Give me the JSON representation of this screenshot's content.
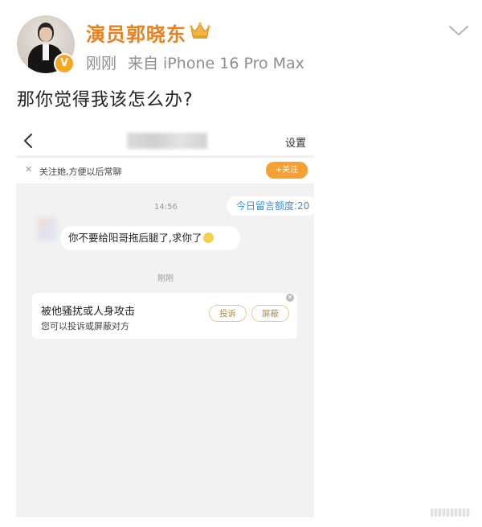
{
  "post": {
    "username": "演员郭晓东",
    "time": "刚刚",
    "source": "来自 iPhone 16 Pro Max",
    "text": "那你觉得我该怎么办?",
    "accent_color": "#e8811e",
    "badge_color": "#f6a623",
    "verified_mark": "V",
    "icons": [
      "crown-icon",
      "chevron-down-icon",
      "verified-badge"
    ]
  },
  "chat_screenshot": {
    "header": {
      "settings_label": "设置",
      "back_icon": "chevron-left-icon"
    },
    "follow_banner": {
      "close_glyph": "✕",
      "text": "关注她,方便以后常聊",
      "button_label": "+关注",
      "button_color": "#f7a034"
    },
    "quota_label": "今日留言额度:20",
    "timestamp_1": "14:56",
    "message": "你不要给阳哥拖后腿了,求你了",
    "emoji": "crying-emoji-icon",
    "timestamp_2": "刚刚",
    "harassment_card": {
      "title": "被他骚扰或人身攻击",
      "subtitle": "您可以投诉或屏蔽对方",
      "complain_label": "投诉",
      "block_label": "屏蔽",
      "close_glyph": "✕"
    }
  }
}
